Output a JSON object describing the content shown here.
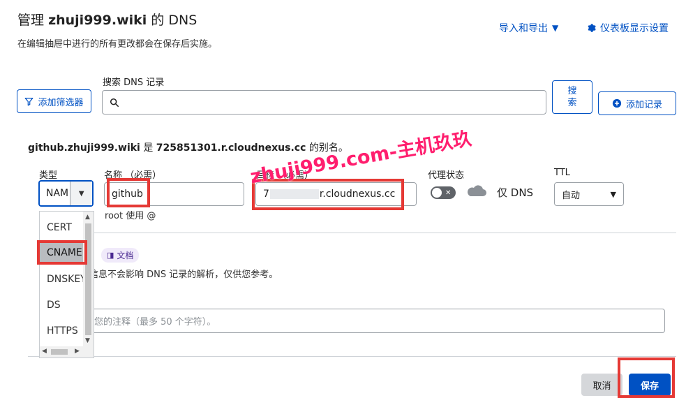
{
  "header": {
    "title_prefix": "管理",
    "domain": "zhuji999.wiki",
    "title_suffix": "的 DNS",
    "subtitle": "在编辑抽屉中进行的所有更改都会在保存后实施。",
    "import_export": "导入和导出",
    "dashboard_settings": "仪表板显示设置"
  },
  "toolbar": {
    "search_label": "搜索 DNS 记录",
    "filter_button": "添加筛选器",
    "search_value": "",
    "search_button": "搜\n索",
    "add_record_button": "添加记录"
  },
  "record": {
    "alias_host": "github.zhuji999.wiki",
    "alias_is": "是",
    "alias_target": "725851301.r.cloudnexus.cc",
    "alias_tail": "的别名。",
    "type_label": "类型",
    "type_value": "NAM",
    "name_label": "名称 （必需）",
    "name_value": "github",
    "name_hint": "root 使用 @",
    "target_label": "目标 （必需）",
    "target_prefix": "7",
    "target_value": "r.cloudnexus.cc",
    "proxy_label": "代理状态",
    "proxy_text": "仅 DNS",
    "ttl_label": "TTL",
    "ttl_value": "自动",
    "doc_tag": "文档",
    "note_info": "信息不会影响 DNS 记录的解析，仅供您参考。",
    "comment_placeholder": "您的注释（最多 50 个字符）。"
  },
  "type_dropdown": {
    "options": [
      "CERT",
      "CNAME",
      "DNSKEY",
      "DS",
      "HTTPS"
    ],
    "selected": "CNAME"
  },
  "footer": {
    "cancel": "取消",
    "save": "保存"
  },
  "watermark": "zhuji999.com-主机玖玖",
  "colors": {
    "accent": "#0051c3",
    "highlight": "#e53935",
    "watermark": "#ff1e6e"
  }
}
